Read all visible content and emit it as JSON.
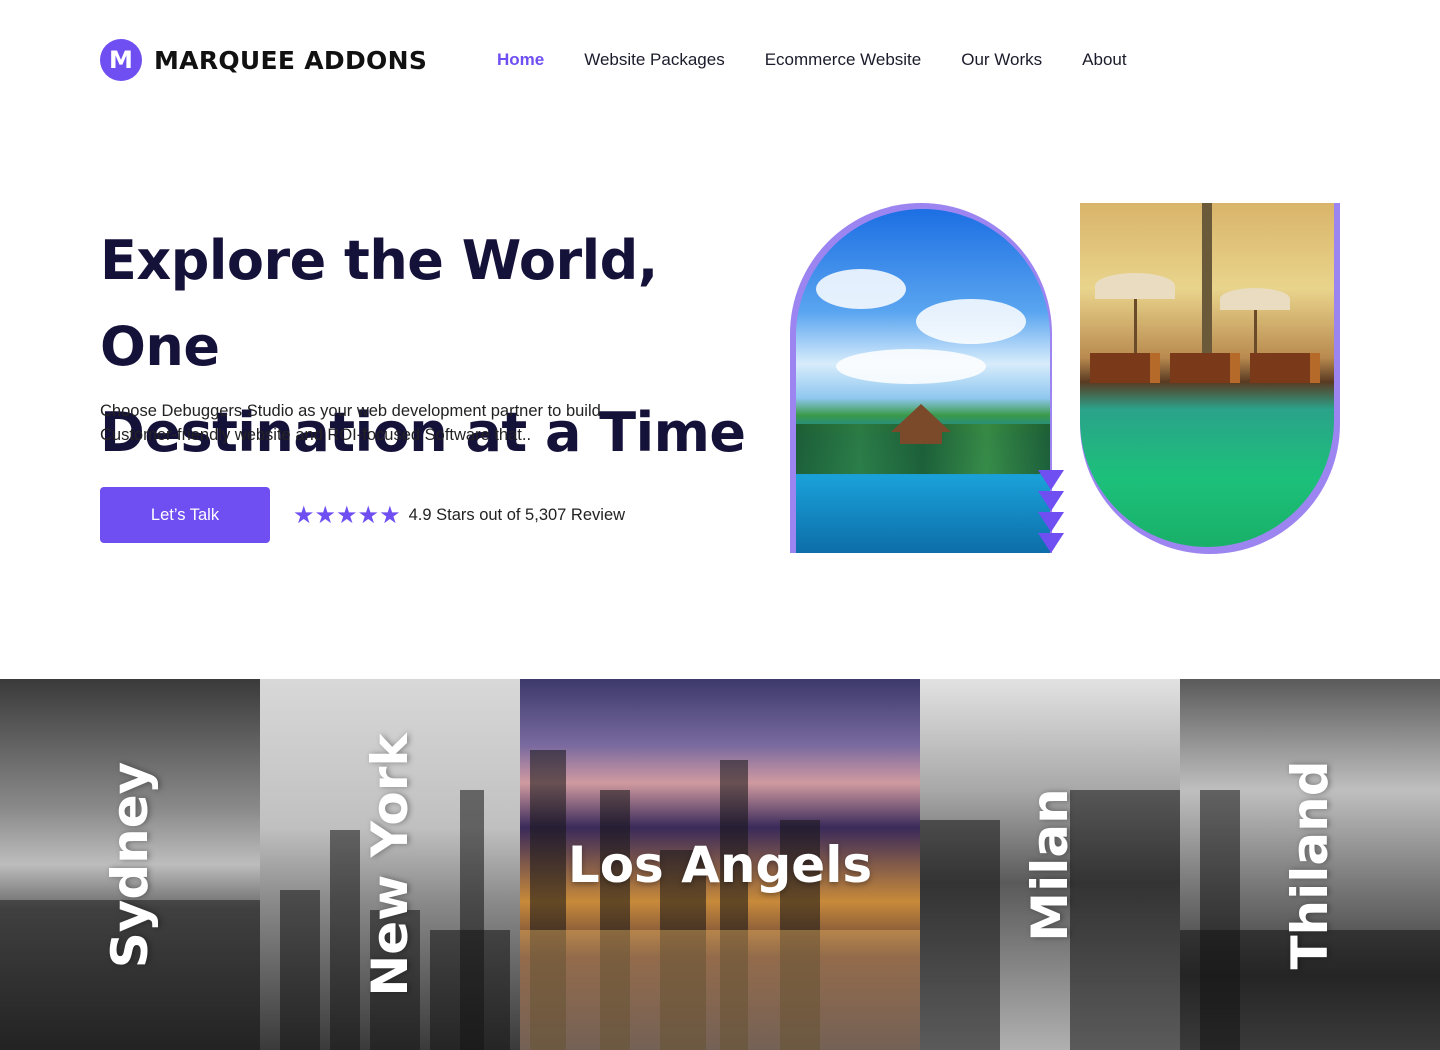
{
  "brand": {
    "logo_letter": "M",
    "name": "MARQUEE ADDONS",
    "color": "#6f4ef2"
  },
  "nav": {
    "items": [
      {
        "label": "Home",
        "active": true
      },
      {
        "label": "Website Packages",
        "active": false
      },
      {
        "label": "Ecommerce Website",
        "active": false
      },
      {
        "label": "Our Works",
        "active": false
      },
      {
        "label": "About",
        "active": false
      }
    ]
  },
  "hero": {
    "title_line1": "Explore the World, One",
    "title_line2": "Destination at a Time",
    "desc_line1": "Choose Debuggers Studio as your web development partner to build",
    "desc_line2": "Customer-friendly website and ROI-focused Software that..",
    "cta_label": "Let’s Talk",
    "stars": "★★★★★",
    "star_rating": 5,
    "rating_text": "4.9 Stars out of 5,307 Review"
  },
  "destinations": [
    {
      "name": "Sydney",
      "orientation": "vertical"
    },
    {
      "name": "New York",
      "orientation": "vertical"
    },
    {
      "name": "Los Angels",
      "orientation": "horizontal"
    },
    {
      "name": "Milan",
      "orientation": "vertical"
    },
    {
      "name": "Thiland",
      "orientation": "vertical"
    }
  ]
}
